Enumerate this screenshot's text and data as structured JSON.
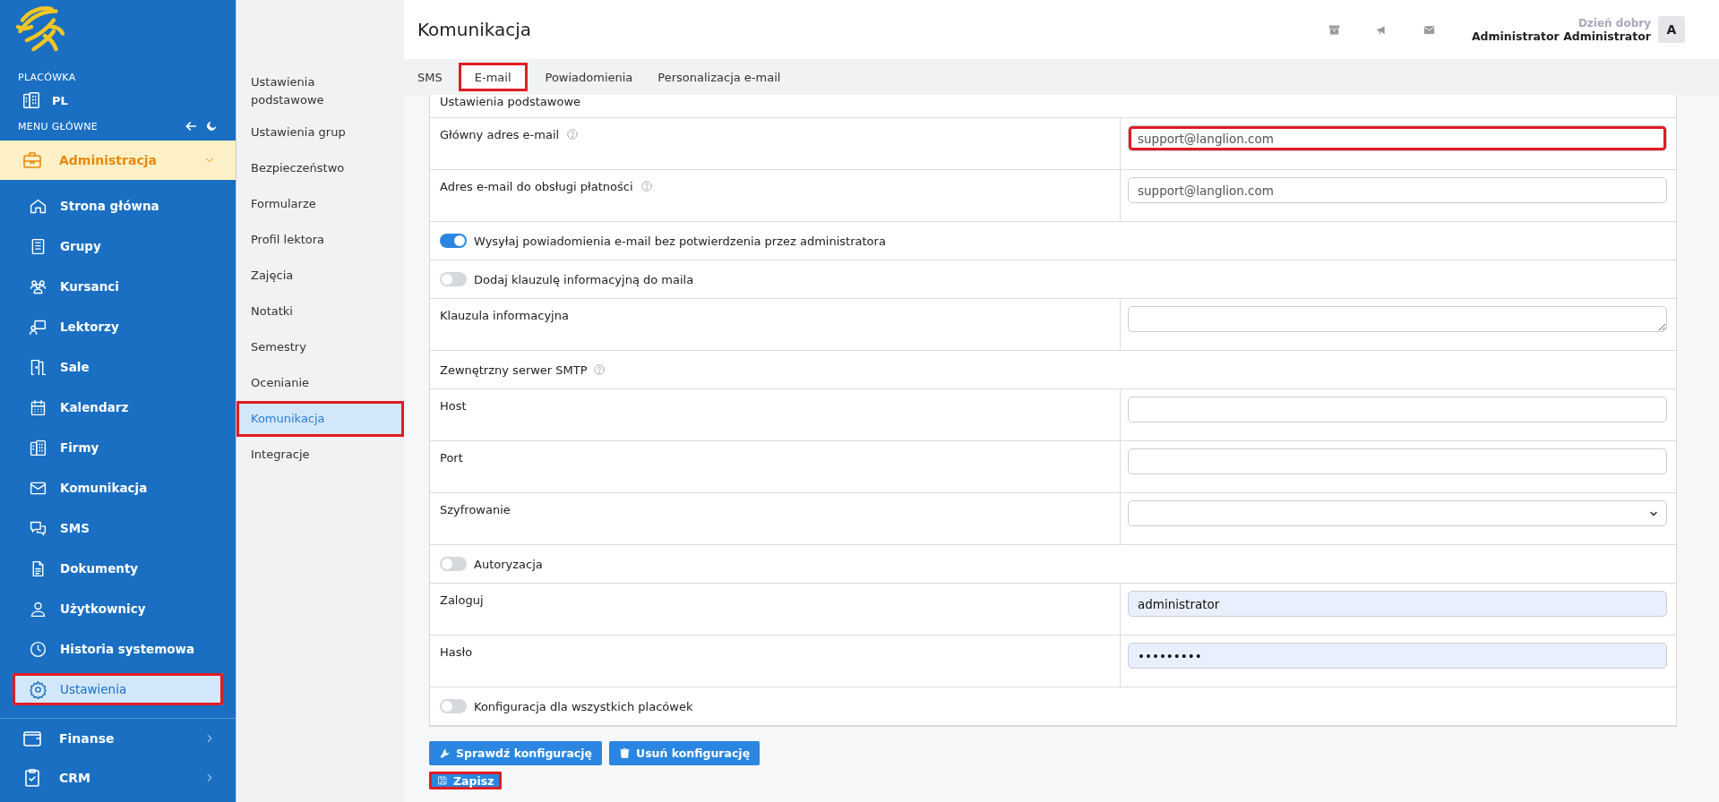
{
  "sidebar": {
    "section_label": "PLACÓWKA",
    "branch": {
      "label": "PL"
    },
    "menu_label": "MENU GŁÓWNE",
    "groups": [
      {
        "label": "Administracja",
        "expanded": true,
        "children": [
          {
            "label": "Strona główna",
            "selected": false,
            "highlighted": false
          },
          {
            "label": "Grupy",
            "selected": false,
            "highlighted": false
          },
          {
            "label": "Kursanci",
            "selected": false,
            "highlighted": false
          },
          {
            "label": "Lektorzy",
            "selected": false,
            "highlighted": false
          },
          {
            "label": "Sale",
            "selected": false,
            "highlighted": false
          },
          {
            "label": "Kalendarz",
            "selected": false,
            "highlighted": false
          },
          {
            "label": "Firmy",
            "selected": false,
            "highlighted": false
          },
          {
            "label": "Komunikacja",
            "selected": false,
            "highlighted": false
          },
          {
            "label": "SMS",
            "selected": false,
            "highlighted": false
          },
          {
            "label": "Dokumenty",
            "selected": false,
            "highlighted": false
          },
          {
            "label": "Użytkownicy",
            "selected": false,
            "highlighted": false
          },
          {
            "label": "Historia systemowa",
            "selected": false,
            "highlighted": false
          },
          {
            "label": "Ustawienia",
            "selected": true,
            "highlighted": true
          }
        ]
      },
      {
        "label": "Finanse",
        "expanded": false
      },
      {
        "label": "CRM",
        "expanded": false
      }
    ]
  },
  "settings_nav": [
    {
      "label": "Ustawienia podstawowe",
      "selected": false,
      "highlighted": false
    },
    {
      "label": "Ustawienia grup",
      "selected": false,
      "highlighted": false
    },
    {
      "label": "Bezpieczeństwo",
      "selected": false,
      "highlighted": false
    },
    {
      "label": "Formularze",
      "selected": false,
      "highlighted": false
    },
    {
      "label": "Profil lektora",
      "selected": false,
      "highlighted": false
    },
    {
      "label": "Zajęcia",
      "selected": false,
      "highlighted": false
    },
    {
      "label": "Notatki",
      "selected": false,
      "highlighted": false
    },
    {
      "label": "Semestry",
      "selected": false,
      "highlighted": false
    },
    {
      "label": "Ocenianie",
      "selected": false,
      "highlighted": false
    },
    {
      "label": "Komunikacja",
      "selected": true,
      "highlighted": true
    },
    {
      "label": "Integracje",
      "selected": false,
      "highlighted": false
    }
  ],
  "header": {
    "title": "Komunikacja",
    "greeting": "Dzień dobry",
    "user_name": "Administrator Administrator",
    "avatar_letter": "A"
  },
  "tabs": [
    {
      "label": "SMS",
      "selected": false,
      "highlighted": false
    },
    {
      "label": "E-mail",
      "selected": true,
      "highlighted": true
    },
    {
      "label": "Powiadomienia",
      "selected": false,
      "highlighted": false
    },
    {
      "label": "Personalizacja e-mail",
      "selected": false,
      "highlighted": false
    }
  ],
  "form_rows": [
    {
      "kind": "section",
      "label": "Ustawienia podstawowe",
      "help": false
    },
    {
      "kind": "field",
      "label": "Główny adres e-mail",
      "help": true,
      "control": {
        "kind": "text",
        "value": "support@langlion.com",
        "autofilled": false,
        "highlighted": true
      }
    },
    {
      "kind": "field",
      "label": "Adres e-mail do obsługi płatności",
      "help": true,
      "control": {
        "kind": "text",
        "value": "support@langlion.com",
        "autofilled": false,
        "highlighted": false
      }
    },
    {
      "kind": "toggle",
      "label": "Wysyłaj powiadomienia e-mail bez potwierdzenia przez administratora",
      "on": true
    },
    {
      "kind": "toggle",
      "label": "Dodaj klauzulę informacyjną do maila",
      "on": false
    },
    {
      "kind": "field",
      "label": "Klauzula informacyjna",
      "help": false,
      "control": {
        "kind": "textarea",
        "autofilled": false,
        "highlighted": false
      }
    },
    {
      "kind": "section",
      "label": "Zewnętrzny serwer SMTP",
      "help": true
    },
    {
      "kind": "field",
      "label": "Host",
      "help": false,
      "control": {
        "kind": "text",
        "autofilled": false,
        "highlighted": false
      }
    },
    {
      "kind": "field",
      "label": "Port",
      "help": false,
      "control": {
        "kind": "text",
        "autofilled": false,
        "highlighted": false
      }
    },
    {
      "kind": "field",
      "label": "Szyfrowanie",
      "help": false,
      "control": {
        "kind": "select",
        "autofilled": false,
        "highlighted": false
      }
    },
    {
      "kind": "toggle",
      "label": "Autoryzacja",
      "on": false
    },
    {
      "kind": "field",
      "label": "Zaloguj",
      "help": false,
      "control": {
        "kind": "text",
        "value": "administrator",
        "autofilled": true,
        "highlighted": false
      }
    },
    {
      "kind": "field",
      "label": "Hasło",
      "help": false,
      "control": {
        "kind": "text",
        "value": "•••••••••",
        "autofilled": true,
        "highlighted": false
      }
    },
    {
      "kind": "toggle",
      "label": "Konfiguracja dla wszystkich placówek",
      "on": false
    }
  ],
  "actions": [
    {
      "label": "Sprawdź konfigurację",
      "highlighted": false
    },
    {
      "label": "Usuń konfigurację",
      "highlighted": false
    }
  ],
  "save_button": {
    "label": "Zapisz",
    "highlighted": true
  }
}
